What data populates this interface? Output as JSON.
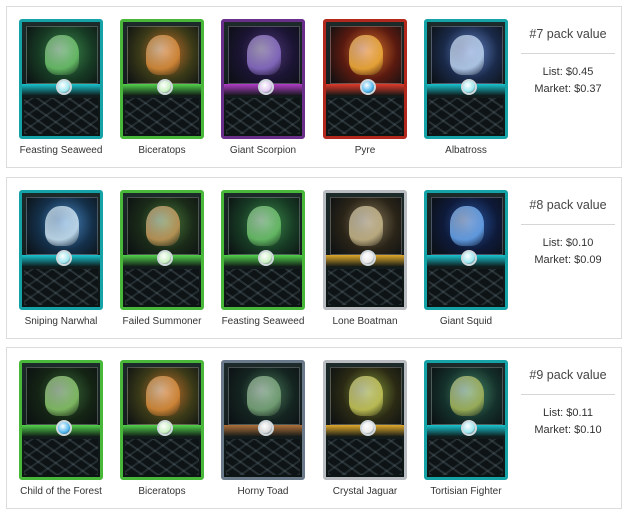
{
  "packs": [
    {
      "title": "#7 pack value",
      "list": "List: $0.45",
      "market": "Market: $0.37",
      "cards": [
        {
          "name": "Feasting Seaweed",
          "frame": "#16a3a8",
          "art1": "#3c8a4a",
          "art2": "#173b24",
          "fig": "#6cc36a",
          "band": "#18c4cf",
          "orb": "#9de8f0"
        },
        {
          "name": "Biceratops",
          "frame": "#49b83a",
          "art1": "#c8702a",
          "art2": "#3a3a18",
          "fig": "#d88b3a",
          "band": "#52d24a",
          "orb": "#c8f0c0"
        },
        {
          "name": "Giant Scorpion",
          "frame": "#6a2f8a",
          "art1": "#4f3a7a",
          "art2": "#1b1433",
          "fig": "#8b6fc8",
          "band": "#b33cc8",
          "orb": "#e0c8f0"
        },
        {
          "name": "Pyre",
          "frame": "#b3281c",
          "art1": "#e0782a",
          "art2": "#5a1a10",
          "fig": "#f0b03a",
          "band": "#e03a2a",
          "orb": "#4fb8f0"
        },
        {
          "name": "Albatross",
          "frame": "#16a3a8",
          "art1": "#6a8ad0",
          "art2": "#1a2a4a",
          "fig": "#bcd4f0",
          "band": "#18c4cf",
          "orb": "#9de8f0"
        }
      ]
    },
    {
      "title": "#8 pack value",
      "list": "List: $0.10",
      "market": "Market: $0.09",
      "cards": [
        {
          "name": "Sniping Narwhal",
          "frame": "#16a3a8",
          "art1": "#4a8ac8",
          "art2": "#14304a",
          "fig": "#cfe6f4",
          "band": "#18c4cf",
          "orb": "#9de8f0"
        },
        {
          "name": "Failed Summoner",
          "frame": "#49b83a",
          "art1": "#4a7a3a",
          "art2": "#1a2a18",
          "fig": "#c89a5a",
          "band": "#52d24a",
          "orb": "#c8f0c0"
        },
        {
          "name": "Feasting Seaweed",
          "frame": "#49b83a",
          "art1": "#3c8a4a",
          "art2": "#173b24",
          "fig": "#6cc36a",
          "band": "#52d24a",
          "orb": "#c8f0c0"
        },
        {
          "name": "Lone Boatman",
          "frame": "#b9bcc0",
          "art1": "#8a7a5a",
          "art2": "#2a2418",
          "fig": "#c8b88a",
          "band": "#e0a82a",
          "orb": "#e8e8e8"
        },
        {
          "name": "Giant Squid",
          "frame": "#16a3a8",
          "art1": "#2a5aa8",
          "art2": "#0e1a3a",
          "fig": "#6aa8f0",
          "band": "#18c4cf",
          "orb": "#9de8f0"
        }
      ]
    },
    {
      "title": "#9 pack value",
      "list": "List: $0.11",
      "market": "Market: $0.10",
      "cards": [
        {
          "name": "Child of the Forest",
          "frame": "#49b83a",
          "art1": "#3a6a3a",
          "art2": "#142414",
          "fig": "#8ac86a",
          "band": "#52d24a",
          "orb": "#4fb8f0"
        },
        {
          "name": "Biceratops",
          "frame": "#49b83a",
          "art1": "#c8702a",
          "art2": "#3a3a18",
          "fig": "#d88b3a",
          "band": "#52d24a",
          "orb": "#c8f0c0"
        },
        {
          "name": "Horny Toad",
          "frame": "#6a7a8a",
          "art1": "#4a7a5a",
          "art2": "#142420",
          "fig": "#7aa87a",
          "band": "#b0703a",
          "orb": "#d8d8d8"
        },
        {
          "name": "Crystal Jaguar",
          "frame": "#b9bcc0",
          "art1": "#8a9a3a",
          "art2": "#2a2a14",
          "fig": "#c8c85a",
          "band": "#e0a82a",
          "orb": "#e8e8e8"
        },
        {
          "name": "Tortisian Fighter",
          "frame": "#16a3a8",
          "art1": "#4a8a6a",
          "art2": "#14302a",
          "fig": "#a8b85a",
          "band": "#18c4cf",
          "orb": "#9de8f0"
        }
      ]
    }
  ]
}
